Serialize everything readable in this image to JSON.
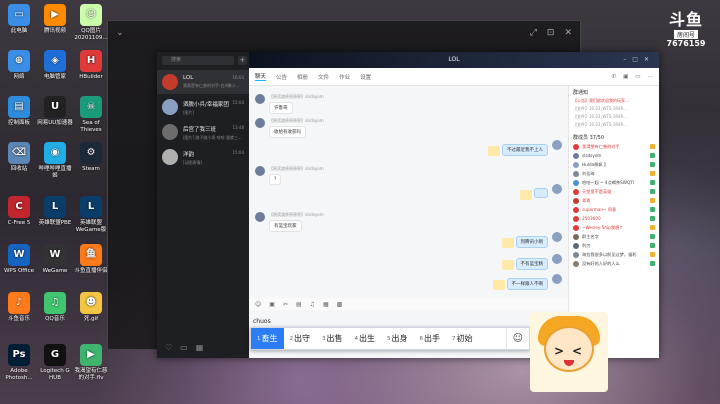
{
  "desktop": {
    "icons": [
      {
        "label": "此电脑",
        "color": "#3a8ee6",
        "glyph": "▭"
      },
      {
        "label": "腾讯视频",
        "color": "#ff8a00",
        "glyph": "▶"
      },
      {
        "label": "QQ图片 20201109...",
        "color": "#cfa",
        "glyph": "☺"
      },
      {
        "label": "网络",
        "color": "#3a8ee6",
        "glyph": "⊕"
      },
      {
        "label": "电脑管家",
        "color": "#1f6fd8",
        "glyph": "◈"
      },
      {
        "label": "HBuilder",
        "color": "#e13a3a",
        "glyph": "H"
      },
      {
        "label": "控制面板",
        "color": "#2f8bdb",
        "glyph": "▤"
      },
      {
        "label": "网易UU加速器",
        "color": "#222",
        "glyph": "U"
      },
      {
        "label": "Sea of Thieves",
        "color": "#1a9c7a",
        "glyph": "☠"
      },
      {
        "label": "回收站",
        "color": "#5a87b5",
        "glyph": "⌫"
      },
      {
        "label": "哔哩哔哩直播姬",
        "color": "#23ade5",
        "glyph": "◉"
      },
      {
        "label": "Steam",
        "color": "#1b2838",
        "glyph": "⚙"
      },
      {
        "label": "C-Free 5",
        "color": "#c0262c",
        "glyph": "C"
      },
      {
        "label": "英雄联盟PBE",
        "color": "#0a3d6a",
        "glyph": "L"
      },
      {
        "label": "英雄联盟WeGame版",
        "color": "#0a3d6a",
        "glyph": "L"
      },
      {
        "label": "WPS Office",
        "color": "#1565c0",
        "glyph": "W"
      },
      {
        "label": "WeGame",
        "color": "#333",
        "glyph": "W"
      },
      {
        "label": "斗鱼直播伴侣",
        "color": "#ff7a1a",
        "glyph": "鱼"
      },
      {
        "label": "斗鱼音乐",
        "color": "#ff7a1a",
        "glyph": "♪"
      },
      {
        "label": "QQ音乐",
        "color": "#3fc66f",
        "glyph": "♫"
      },
      {
        "label": "死.gif",
        "color": "#f4c542",
        "glyph": "☻"
      },
      {
        "label": "Adobe Photosh...",
        "color": "#001e36",
        "glyph": "Ps"
      },
      {
        "label": "Logitech G HUB",
        "color": "#111",
        "glyph": "G"
      },
      {
        "label": "我渴望有仁慈的对手.flv",
        "color": "#3fb46f",
        "glyph": "▶"
      }
    ]
  },
  "stream": {
    "logo": "斗鱼",
    "room_label": "房间号",
    "room_number": "7676159"
  },
  "qq": {
    "search_placeholder": "搜索",
    "plus": "+",
    "conversations": [
      {
        "name": "LOL",
        "preview": "我真是有仁慈的对手-白A爆小...",
        "time": "16:04",
        "color": "#c23b2b",
        "active": true
      },
      {
        "name": "洒脱小兵/幸福家团",
        "preview": "[图片]",
        "time": "15:04",
        "color": "#8aa0c0",
        "active": false
      },
      {
        "name": "后宫了我三班",
        "preview": "[图片] 路子路小哥 哈哈 我就三...",
        "time": "13:48",
        "color": "#6c6c6c",
        "active": false
      },
      {
        "name": "洋韵",
        "preview": "[动图表情]",
        "time": "15:04",
        "color": "#b0b0b0",
        "active": false
      }
    ],
    "chat_title": "LOL",
    "tabs": [
      "聊天",
      "公告",
      "相册",
      "文件",
      "作业",
      "设置"
    ],
    "messages_left": [
      {
        "meta": "【原滨渡原原原原】slsdsyom",
        "text": "许鲁哥"
      },
      {
        "meta": "【原滨渡原原原原】slsdsyom",
        "text": "收拾有收获吗"
      },
      {
        "meta": "【原滨渡原原原原】slsdsyom",
        "text": "?"
      },
      {
        "meta": "【原滨渡原原原原】slsdsyom",
        "text": "有蓝宝玩家"
      }
    ],
    "messages_right": [
      {
        "text": "不过最近我不上人"
      },
      {
        "text": ""
      },
      {
        "text": "到腾讯小刚"
      },
      {
        "text": "不有蓝宝精"
      },
      {
        "text": "不一样跟人不啊"
      }
    ],
    "notice_title": "群通知",
    "notice_lines": [
      "【公告】我们群欢迎我的玩家…",
      "【文件】10.23_WTS-1649…",
      "【文件】10.23_WTS-1649…",
      "【文件】10.23_WTS-1649…"
    ],
    "members_title": "群成员 37/50",
    "members": [
      {
        "name": "我渴望有仁慈的对手",
        "color": "#e03a3a",
        "hl": true
      },
      {
        "name": "slsdsyom",
        "color": "#6b7d99",
        "hl": false
      },
      {
        "name": "Hulda佩佩 】",
        "color": "#8aa0c0",
        "hl": false
      },
      {
        "name": "刘佳琦",
        "color": "#7a8a9a",
        "hl": false
      },
      {
        "name": "哈哈一起 ~ 4点喝茶SWQTI",
        "color": "#4a90d9",
        "hl": false
      },
      {
        "name": "天堂里不是英雄",
        "color": "#e03a3a",
        "hl": true
      },
      {
        "name": "青青",
        "color": "#c23b2b",
        "hl": true
      },
      {
        "name": "superman~ 同意",
        "color": "#e03a3a",
        "hl": true
      },
      {
        "name": "2503600",
        "color": "#e03a3a",
        "hl": true
      },
      {
        "name": "~Wesley Ship我想↑",
        "color": "#e03a3a",
        "hl": true
      },
      {
        "name": "群主名字",
        "color": "#7a6a5a",
        "hl": false
      },
      {
        "name": "利刃",
        "color": "#5a6a7a",
        "hl": false
      },
      {
        "name": "海拉我很多以前见过梦，福利",
        "color": "#7a8a9a",
        "hl": false
      },
      {
        "name": "没有好的人好的人么",
        "color": "#8a7a6a",
        "hl": false
      }
    ],
    "toolbar_icons": [
      "☺",
      "▣",
      "✂",
      "▤",
      "♫",
      "▦",
      "▩"
    ],
    "input_text": "chuos"
  },
  "ime": {
    "candidates": [
      {
        "n": "1",
        "text": "畜生",
        "selected": true
      },
      {
        "n": "2",
        "text": "出守",
        "selected": false
      },
      {
        "n": "3",
        "text": "出售",
        "selected": false
      },
      {
        "n": "4",
        "text": "出生",
        "selected": false
      },
      {
        "n": "5",
        "text": "出身",
        "selected": false
      },
      {
        "n": "6",
        "text": "出手",
        "selected": false
      },
      {
        "n": "7",
        "text": "初始",
        "selected": false
      }
    ],
    "emoji": "☺"
  },
  "video_window": {
    "back": "⌄",
    "controls": [
      "⤢",
      "⊡",
      "✕"
    ]
  }
}
